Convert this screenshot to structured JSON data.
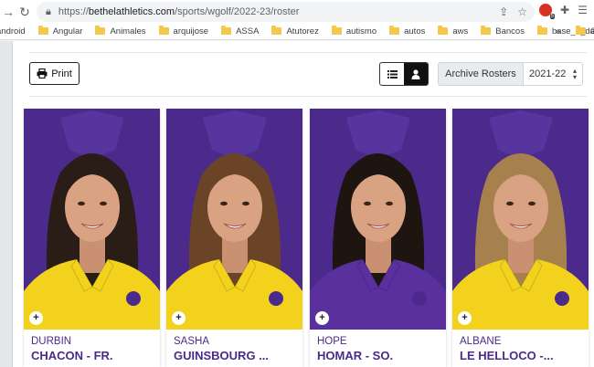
{
  "browser": {
    "url_host": "bethelathletics.com",
    "url_path": "/sports/wgolf/2022-23/roster",
    "url_scheme": "https://",
    "extension_badge": "5"
  },
  "bookmarks": [
    "android",
    "Angular",
    "Animales",
    "arquijose",
    "ASSA",
    "Atutorez",
    "autismo",
    "autos",
    "aws",
    "Bancos",
    "base_d_datos",
    "»",
    "Ot"
  ],
  "toolbar": {
    "print_label": "Print",
    "archive_label": "Archive Rosters",
    "season_value": "2021-22"
  },
  "roster": [
    {
      "first": "DURBIN",
      "last": "CHACON - FR.",
      "hair": "#2a1c16",
      "shirt": "#f2d21c"
    },
    {
      "first": "SASHA",
      "last": "GUINSBOURG ...",
      "hair": "#6b4326",
      "shirt": "#f2d21c"
    },
    {
      "first": "HOPE",
      "last": "HOMAR - SO.",
      "hair": "#1e1410",
      "shirt": "#5a2f9e"
    },
    {
      "first": "ALBANE",
      "last": "LE HELLOCO -...",
      "hair": "#a6814d",
      "shirt": "#f2d21c"
    }
  ],
  "colors": {
    "brand_purple": "#4b2a8c",
    "brand_gold": "#f2d21c"
  }
}
